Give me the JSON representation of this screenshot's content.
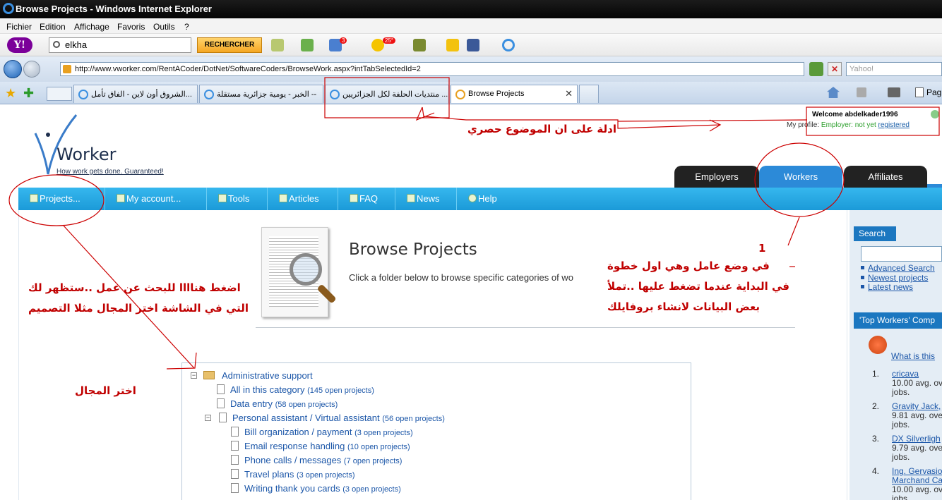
{
  "window": {
    "title": "Browse Projects - Windows Internet Explorer"
  },
  "menu": [
    "Fichier",
    "Edition",
    "Affichage",
    "Favoris",
    "Outils",
    "?"
  ],
  "yahoo_toolbar": {
    "logo": "Y!",
    "search_value": "elkha",
    "search_button": "RECHERCHER",
    "mail_count": "3",
    "weather": "25°"
  },
  "address": {
    "url": "http://www.vworker.com/RentACoder/DotNet/SoftwareCoders/BrowseWork.aspx?intTabSelectedId=2",
    "search_placeholder": "Yahoo!"
  },
  "tabs": [
    "الشروق أون لاين - الفاق تأمل...",
    "الخبر - يومية جزائرية مستقلة --",
    "منتديات الحلفة لكل الجزائريين ...",
    "Browse Projects"
  ],
  "page_menu": "Pag",
  "site": {
    "logo_text": "Worker",
    "tagline": "How work gets done. Guaranteed!",
    "welcome": "Welcome abdelkader1996",
    "profile_label": "My profile:",
    "profile_status": "Employer: not yet",
    "profile_link": "registered",
    "top_tabs": [
      "Employers",
      "Workers",
      "Affiliates"
    ],
    "nav": [
      "Projects...",
      "My account...",
      "Tools",
      "Articles",
      "FAQ",
      "News",
      "Help"
    ]
  },
  "main": {
    "title": "Browse Projects",
    "subtitle": "Click a folder below to browse specific categories of wo"
  },
  "tree": [
    {
      "label": "Administrative support",
      "count": ""
    },
    {
      "label": "All in this category",
      "count": "(145 open projects)"
    },
    {
      "label": "Data entry",
      "count": "(58 open projects)"
    },
    {
      "label": "Personal assistant / Virtual assistant",
      "count": "(56 open projects)"
    },
    {
      "label": "Bill organization / payment",
      "count": "(3 open projects)"
    },
    {
      "label": "Email response handling",
      "count": "(10 open projects)"
    },
    {
      "label": "Phone calls / messages",
      "count": "(7 open projects)"
    },
    {
      "label": "Travel plans",
      "count": "(3 open projects)"
    },
    {
      "label": "Writing thank you cards",
      "count": "(3 open projects)"
    }
  ],
  "sidebar": {
    "search_title": "Search",
    "links": [
      "Advanced Search",
      "Newest projects",
      "Latest news"
    ],
    "top_workers_title": "'Top Workers' Comp",
    "what_is_this": "What is this",
    "workers": [
      {
        "num": "1.",
        "name": "cricava",
        "score": "10.00 avg. ov",
        "jobs": "jobs."
      },
      {
        "num": "2.",
        "name": "Gravity Jack,",
        "score": "9.81 avg. ove",
        "jobs": "jobs."
      },
      {
        "num": "3.",
        "name": "DX Silverligh",
        "score": "9.79 avg. ove",
        "jobs": "jobs."
      },
      {
        "num": "4.",
        "name": "Ing. Gervasio",
        "name2": "Marchand Ca",
        "score": "10.00 avg. ov",
        "jobs": "jobs."
      }
    ]
  },
  "annotations": {
    "tab_note": "ادلة على ان الموضوع حصري",
    "step_number": "1",
    "workers_note_1": "في وضع عامل وهي اول خطوة",
    "workers_note_2": "في البداية عندما تضغط عليها ..تملأ",
    "workers_note_3": "بعض البيانات لانشاء بروفايلك",
    "projects_note_1": "اضغط هناااا للبحث عن عمل ..ستظهر لك",
    "projects_note_2": "التي في الشاشة اختر المجال مثلا التصميم",
    "field_note": "اختر المجال"
  }
}
